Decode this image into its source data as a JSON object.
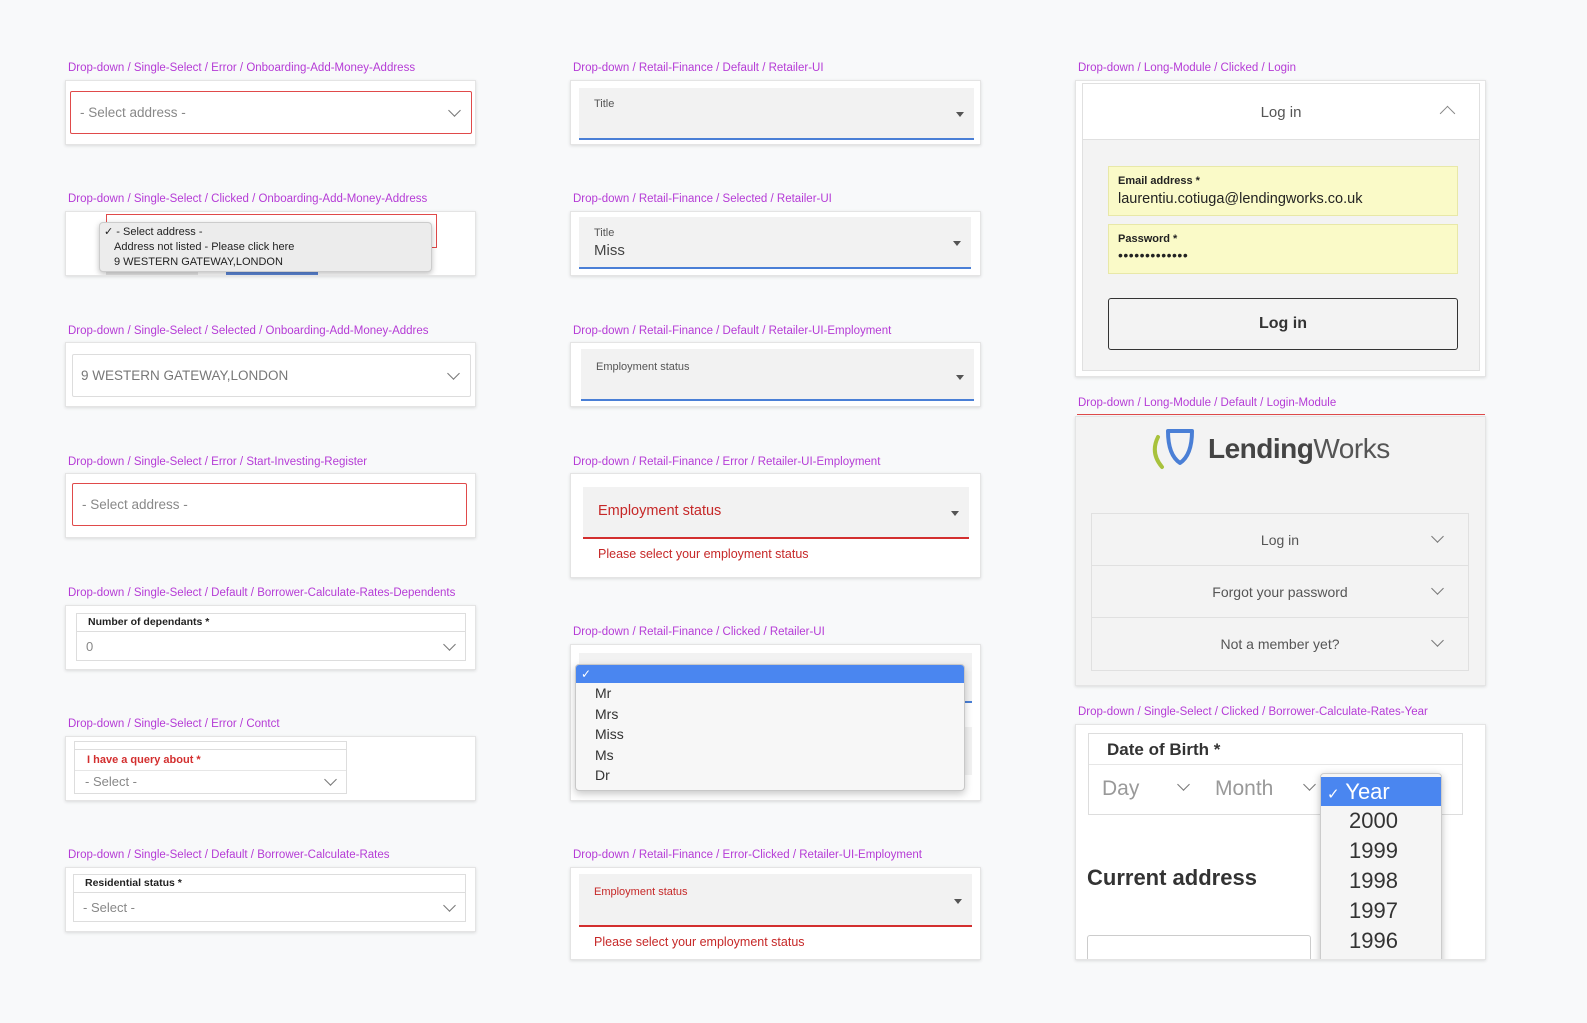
{
  "col1": {
    "c1": {
      "label": "Drop-down / Single-Select / Error / Onboarding-Add-Money-Address",
      "placeholder": "- Select address -"
    },
    "c2": {
      "label": "Drop-down / Single-Select / Clicked / Onboarding-Add-Money-Address",
      "options": [
        "- Select address -",
        "Address not listed - Please click here",
        "9 WESTERN GATEWAY,LONDON"
      ],
      "check": "✓"
    },
    "c3": {
      "label": "Drop-down / Single-Select / Selected / Onboarding-Add-Money-Addres",
      "value": "9 WESTERN GATEWAY,LONDON"
    },
    "c4": {
      "label": "Drop-down / Single-Select / Error / Start-Investing-Register",
      "placeholder": "- Select address -"
    },
    "c5": {
      "label": "Drop-down / Single-Select / Default / Borrower-Calculate-Rates-Dependents",
      "field_label": "Number of dependants *",
      "value": "0"
    },
    "c6": {
      "label": "Drop-down / Single-Select / Error / Contct",
      "field_label": "I have a query about *",
      "placeholder": "- Select -"
    },
    "c7": {
      "label": "Drop-down / Single-Select / Default / Borrower-Calculate-Rates",
      "field_label": "Residential status *",
      "placeholder": "- Select -"
    }
  },
  "col2": {
    "c1": {
      "label": "Drop-down / Retail-Finance / Default / Retailer-UI",
      "field_label": "Title"
    },
    "c2": {
      "label": "Drop-down / Retail-Finance / Selected / Retailer-UI",
      "field_label": "Title",
      "value": "Miss"
    },
    "c3": {
      "label": "Drop-down / Retail-Finance / Default / Retailer-UI-Employment",
      "field_label": "Employment status"
    },
    "c4": {
      "label": "Drop-down / Retail-Finance / Error / Retailer-UI-Employment",
      "field_label": "Employment status",
      "error": "Please select your employment status"
    },
    "c5": {
      "label": "Drop-down / Retail-Finance / Clicked / Retailer-UI",
      "check": "✓",
      "options": [
        "Mr",
        "Mrs",
        "Miss",
        "Ms",
        "Dr"
      ]
    },
    "c6": {
      "label": "Drop-down / Retail-Finance / Error-Clicked / Retailer-UI-Employment",
      "field_label": "Employment status",
      "error": "Please select your employment status"
    }
  },
  "col3": {
    "c1": {
      "label": "Drop-down / Long-Module / Clicked / Login",
      "header": "Log in",
      "email_label": "Email address *",
      "email_value": "laurentiu.cotiuga@lendingworks.co.uk",
      "password_label": "Password *",
      "password_value": "•••••••••••••",
      "button": "Log in"
    },
    "c2": {
      "label": "Drop-down / Long-Module / Default / Login-Module",
      "logo_bold": "Lending",
      "logo_light": "Works",
      "rows": [
        "Log in",
        "Forgot your password",
        "Not a member yet?"
      ]
    },
    "c3": {
      "label": "Drop-down / Single-Select / Clicked / Borrower-Calculate-Rates-Year",
      "dob_label": "Date of Birth *",
      "day": "Day",
      "month": "Month",
      "check": "✓",
      "year_selected": "Year",
      "years": [
        "2000",
        "1999",
        "1998",
        "1997",
        "1996"
      ],
      "current_address": "Current address"
    }
  },
  "colors": {
    "label": "#b53bd6",
    "error": "#d32f2f",
    "focus": "#4a7fd6",
    "autofill": "#fafac8",
    "menu_selected": "#4a86f0"
  }
}
